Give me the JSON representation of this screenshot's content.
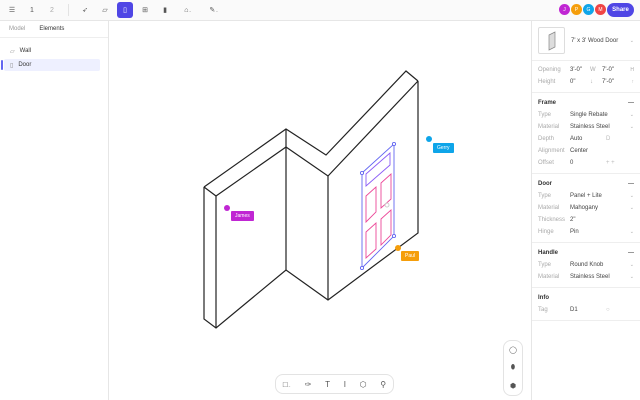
{
  "toolbar": {
    "menu_icon": "menu-icon",
    "level1": "1",
    "level2": "2",
    "tools": [
      "select-icon",
      "wall-icon",
      "door-icon",
      "window-icon",
      "column-icon",
      "roof-icon",
      "annotate-icon"
    ],
    "active_tool": "door-icon"
  },
  "collaborators": [
    {
      "initial": "J",
      "color": "#c026d3"
    },
    {
      "initial": "P",
      "color": "#f59e0b"
    },
    {
      "initial": "G",
      "color": "#0ea5e9"
    },
    {
      "initial": "M",
      "color": "#ef4444"
    }
  ],
  "share_label": "Share",
  "left_panel": {
    "tabs": [
      "Model",
      "Elements"
    ],
    "active_tab": "Elements",
    "items": [
      {
        "label": "Wall",
        "icon": "wall-icon"
      },
      {
        "label": "Door",
        "icon": "door-icon",
        "selected": true
      }
    ]
  },
  "canvas": {
    "cursors": [
      {
        "name": "James",
        "color": "#c026d3"
      },
      {
        "name": "Gerry",
        "color": "#0ea5e9"
      },
      {
        "name": "Paul",
        "color": "#f59e0b"
      }
    ]
  },
  "props": {
    "title": "7' x 3' Wood Door",
    "opening": {
      "label": "Opening",
      "w": "3'-0\"",
      "w_label": "W",
      "h": "7'-0\"",
      "h_label": "H"
    },
    "height": {
      "label": "Height",
      "v1": "0\"",
      "v2": "7'-0\""
    },
    "frame": {
      "title": "Frame",
      "rows": [
        {
          "label": "Type",
          "value": "Single Rebate",
          "dropdown": true
        },
        {
          "label": "Material",
          "value": "Stainless Steel",
          "dropdown": true
        },
        {
          "label": "Depth",
          "value": "Auto",
          "suffix": "D"
        },
        {
          "label": "Alignment",
          "value": "Center"
        },
        {
          "label": "Offset",
          "value": "0",
          "suffix": "+ +"
        }
      ]
    },
    "door": {
      "title": "Door",
      "rows": [
        {
          "label": "Type",
          "value": "Panel + Lite",
          "dropdown": true
        },
        {
          "label": "Material",
          "value": "Mahogany",
          "dropdown": true
        },
        {
          "label": "Thickness",
          "value": "2\""
        },
        {
          "label": "Hinge",
          "value": "Pin",
          "dropdown": true
        }
      ]
    },
    "handle": {
      "title": "Handle",
      "rows": [
        {
          "label": "Type",
          "value": "Round Knob",
          "dropdown": true
        },
        {
          "label": "Material",
          "value": "Stainless Steel",
          "dropdown": true
        }
      ]
    },
    "info": {
      "title": "Info",
      "rows": [
        {
          "label": "Tag",
          "value": "D1",
          "suffix": "○"
        }
      ]
    }
  },
  "bottom_tools": [
    "rectangle-icon",
    "pen-icon",
    "text-icon",
    "dimension-icon",
    "hexagon-icon",
    "pin-icon"
  ],
  "side_tools": [
    "comment-icon",
    "person-icon",
    "cube-icon"
  ]
}
